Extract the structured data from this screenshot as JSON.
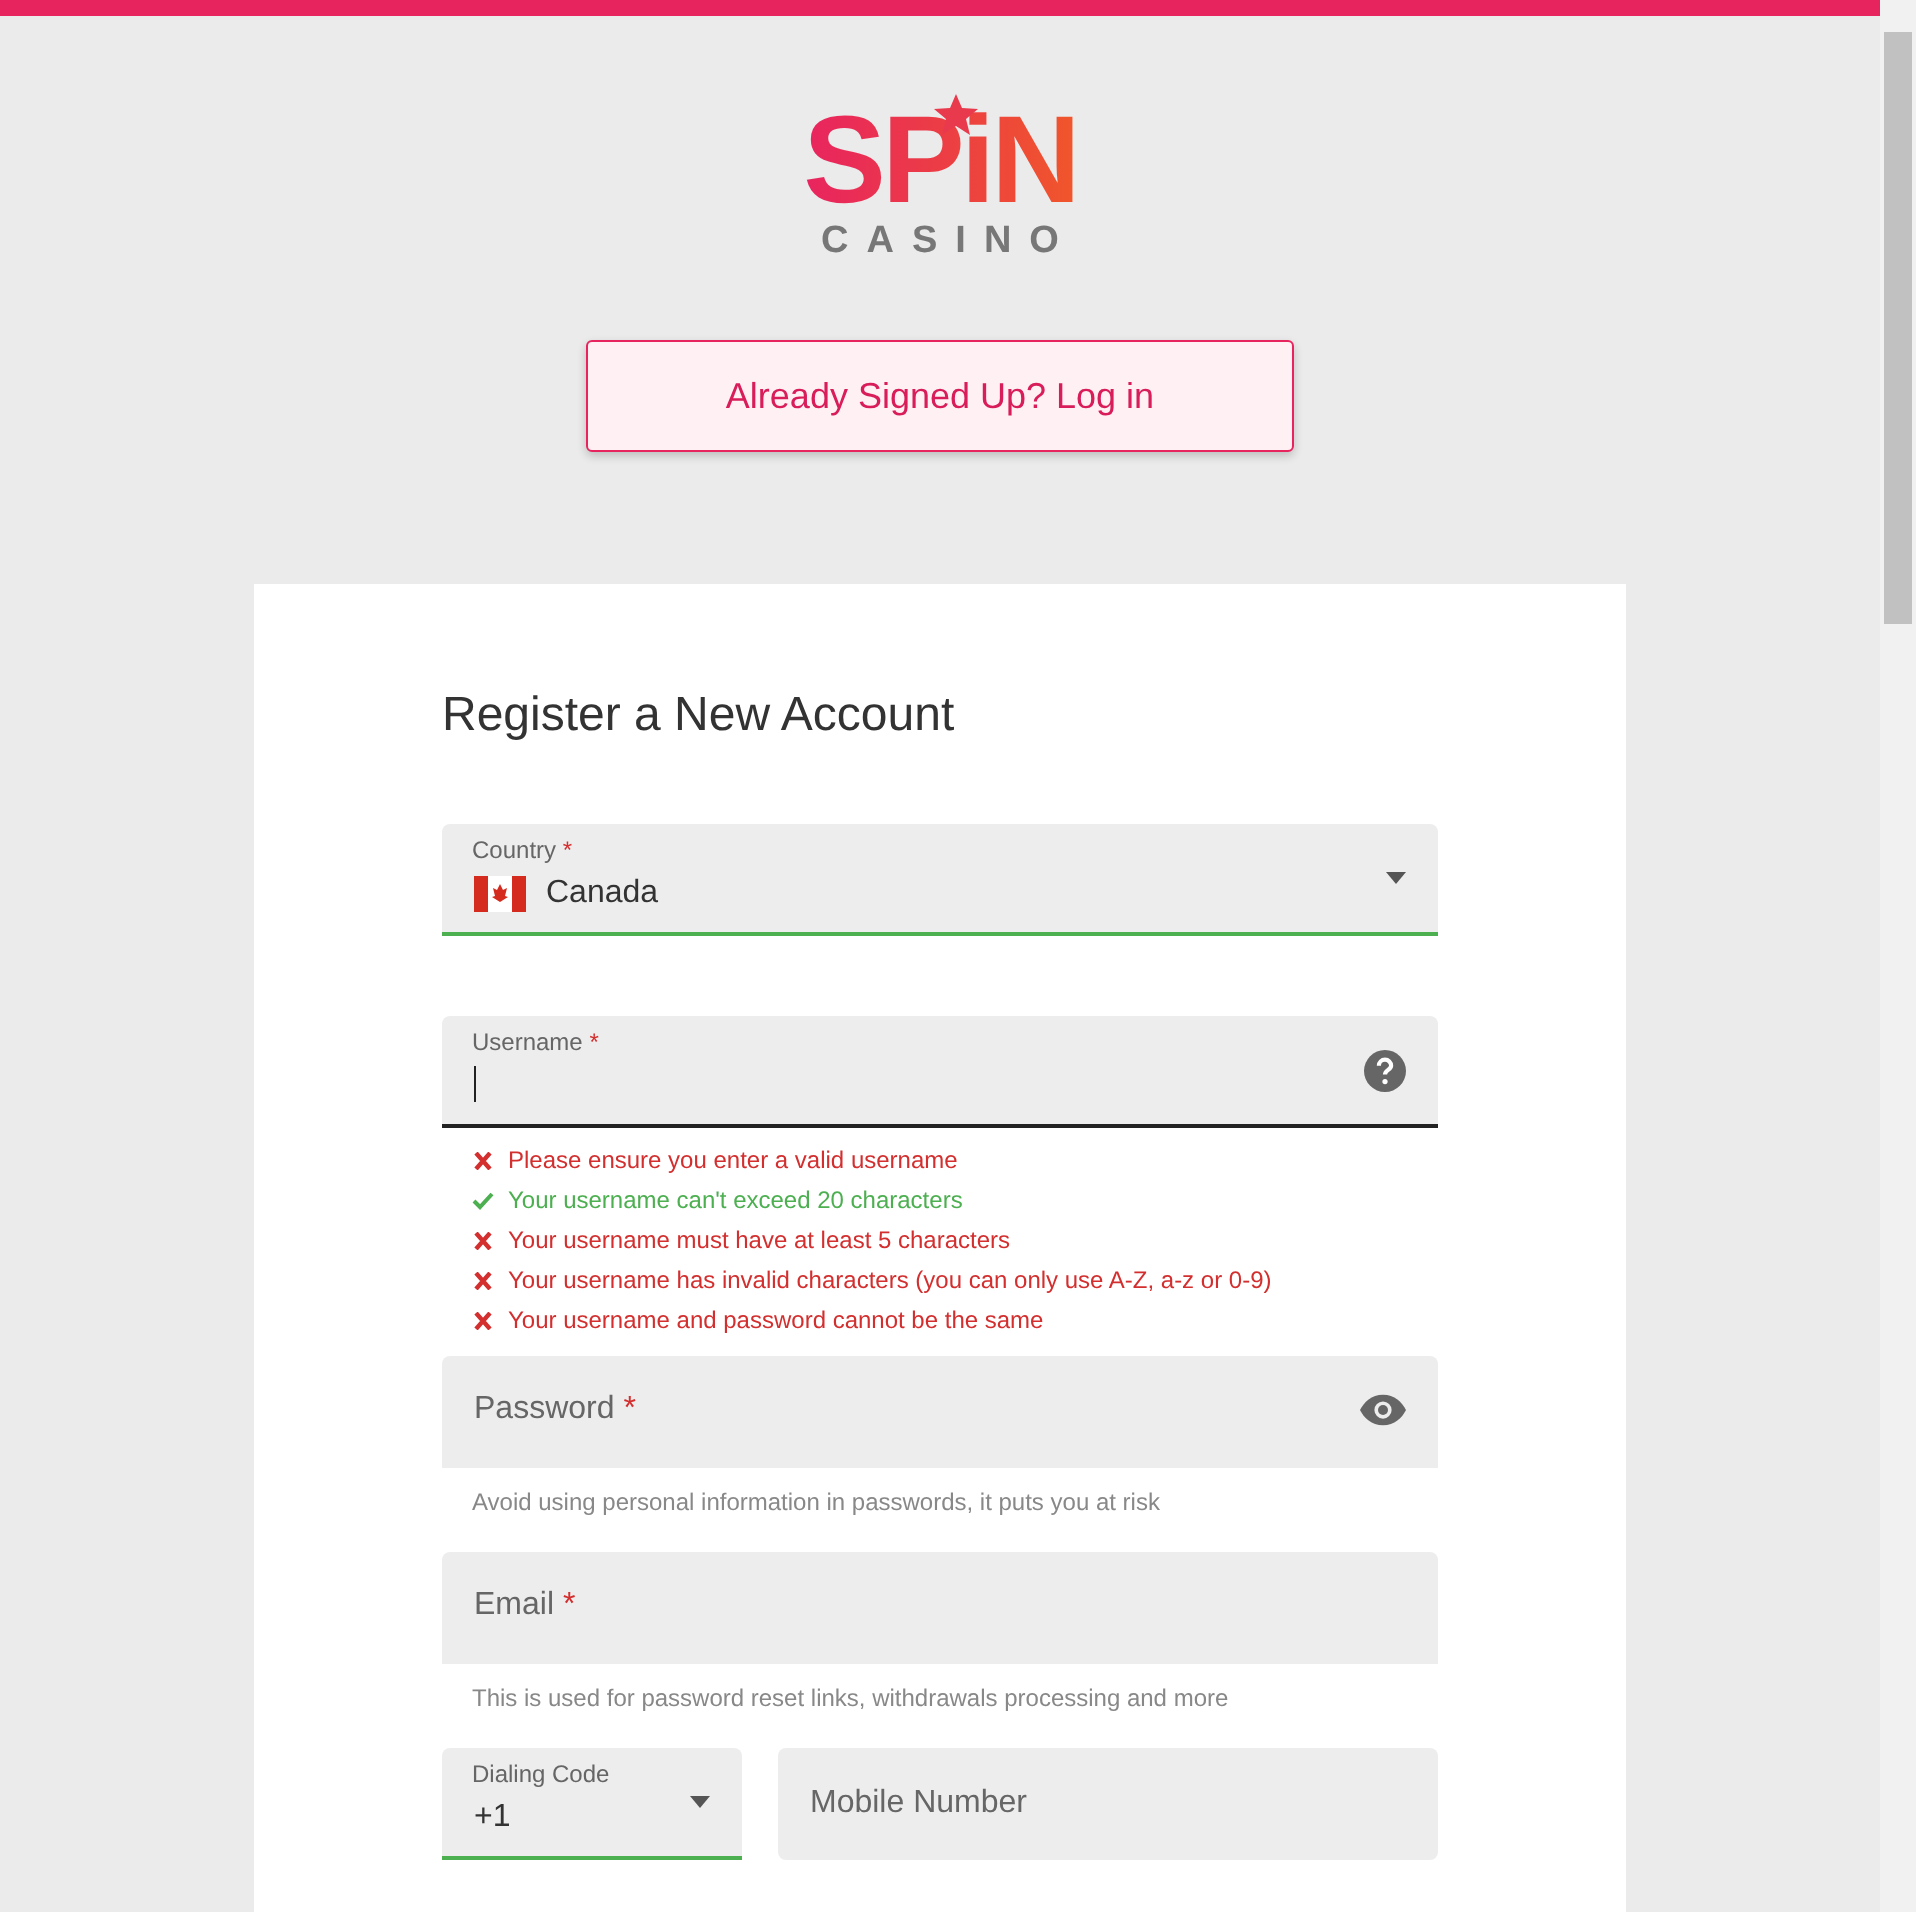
{
  "logo": {
    "word": "SPiN",
    "sub": "CASINO"
  },
  "login_button": "Already Signed Up? Log in",
  "form": {
    "title": "Register a New Account",
    "country": {
      "label": "Country",
      "required_mark": "*",
      "value": "Canada",
      "valid": true
    },
    "username": {
      "label": "Username",
      "required_mark": "*",
      "focused": true
    },
    "rules": [
      {
        "text": "Please ensure you enter a valid username",
        "passed": false
      },
      {
        "text": "Your username can't exceed 20 characters",
        "passed": true
      },
      {
        "text": "Your username must have at least 5 characters",
        "passed": false
      },
      {
        "text": "Your username has invalid characters (you can only use A-Z, a-z or 0-9)",
        "passed": false
      },
      {
        "text": "Your username and password cannot be the same",
        "passed": false
      }
    ],
    "password": {
      "label": "Password",
      "required_mark": "*",
      "hint": "Avoid using personal information in passwords, it puts you at risk"
    },
    "email": {
      "label": "Email",
      "required_mark": "*",
      "hint": "This is used for password reset links, withdrawals processing and more"
    },
    "dialing": {
      "label": "Dialing Code",
      "value": "+1",
      "valid": true
    },
    "mobile": {
      "placeholder": "Mobile Number"
    }
  }
}
